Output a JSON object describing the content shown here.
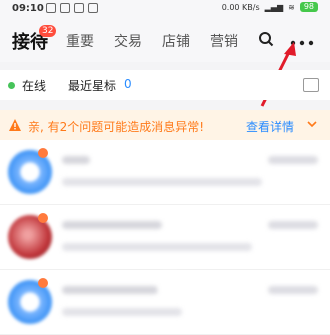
{
  "status": {
    "time": "09:10",
    "right_text": "0.00 KB/s",
    "battery": "98"
  },
  "header": {
    "tabs": [
      {
        "label": "接待",
        "active": true
      },
      {
        "label": "重要"
      },
      {
        "label": "交易"
      },
      {
        "label": "店铺"
      },
      {
        "label": "营销"
      }
    ],
    "badge": "32"
  },
  "filter": {
    "online_label": "在线",
    "star_label": "最近星标",
    "star_count": "0"
  },
  "alert": {
    "message": "亲, 有2个问题可能造成消息异常!",
    "link": "查看详情"
  },
  "colors": {
    "accent_blue": "#2a8cff",
    "warning_orange": "#ff7a1a",
    "badge_red": "#ff4d3d",
    "online_green": "#46c35a",
    "arrow_red": "#e11b2a"
  },
  "list_rows": [
    "row-1",
    "row-2",
    "row-3"
  ]
}
